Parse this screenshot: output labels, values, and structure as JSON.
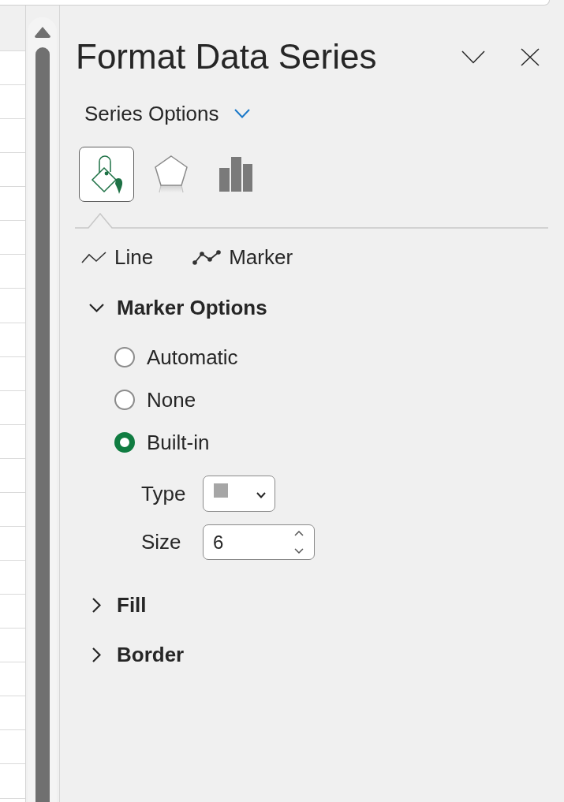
{
  "pane": {
    "title": "Format Data Series",
    "options_menu": {
      "label": "Series Options"
    },
    "category_tabs": [
      {
        "kind": "fill_line",
        "selected": true
      },
      {
        "kind": "effects",
        "selected": false
      },
      {
        "kind": "series_options",
        "selected": false
      }
    ],
    "subtabs": [
      {
        "kind": "line",
        "label": "Line"
      },
      {
        "kind": "marker",
        "label": "Marker"
      }
    ],
    "sections": [
      {
        "title": "Marker Options",
        "expanded": true,
        "options": [
          {
            "label": "Automatic",
            "selected": false
          },
          {
            "label": "None",
            "selected": false
          },
          {
            "label": "Built-in",
            "selected": true
          }
        ],
        "fields": [
          {
            "kind": "dropdown",
            "label": "Type"
          },
          {
            "kind": "spinner",
            "label": "Size",
            "value": "6"
          }
        ]
      },
      {
        "title": "Fill",
        "expanded": false
      },
      {
        "title": "Border",
        "expanded": false
      }
    ]
  }
}
